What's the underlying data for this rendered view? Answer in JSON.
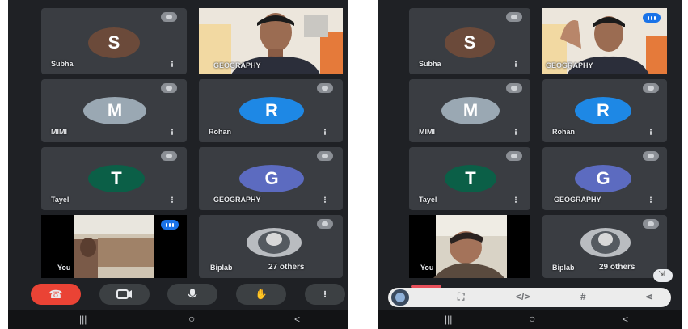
{
  "left": {
    "tiles": [
      {
        "name": "Subha",
        "initial": "S",
        "color": "#6b4a3a"
      },
      {
        "name": "MIMI",
        "initial": "M",
        "color": "#9aa8b3"
      },
      {
        "name": "Rohan",
        "initial": "R",
        "color": "#1e88e5"
      },
      {
        "name": "Tayel",
        "initial": "T",
        "color": "#0b5f47"
      },
      {
        "name": "GEOGRAPHY",
        "initial": "G",
        "color": "#5c6bc0"
      }
    ],
    "video_top_name": "GEOGRAPHY",
    "video_bottom_name": "You",
    "others_name": "Biplab",
    "others_count": "27 others",
    "controls": {
      "end_call": "end-call",
      "camera": "camera",
      "mic": "mic",
      "hand": "raise-hand",
      "more": "more"
    }
  },
  "right": {
    "tiles": [
      {
        "name": "Subha",
        "initial": "S",
        "color": "#6b4a3a"
      },
      {
        "name": "MIMI",
        "initial": "M",
        "color": "#9aa8b3"
      },
      {
        "name": "Rohan",
        "initial": "R",
        "color": "#1e88e5"
      },
      {
        "name": "Tayel",
        "initial": "T",
        "color": "#0b5f47"
      },
      {
        "name": "GEOGRAPHY",
        "initial": "G",
        "color": "#5c6bc0"
      }
    ],
    "video_top_name": "GEOGRAPHY",
    "video_bottom_name": "You",
    "others_name": "Biplab",
    "others_count": "29 others"
  },
  "nav": {
    "recents": "|||",
    "home": "○",
    "back": "<"
  },
  "colors": {
    "end_call": "#ea4335",
    "speaking": "#1a73e8",
    "tile": "#3a3d42",
    "bg": "#1f2125"
  }
}
